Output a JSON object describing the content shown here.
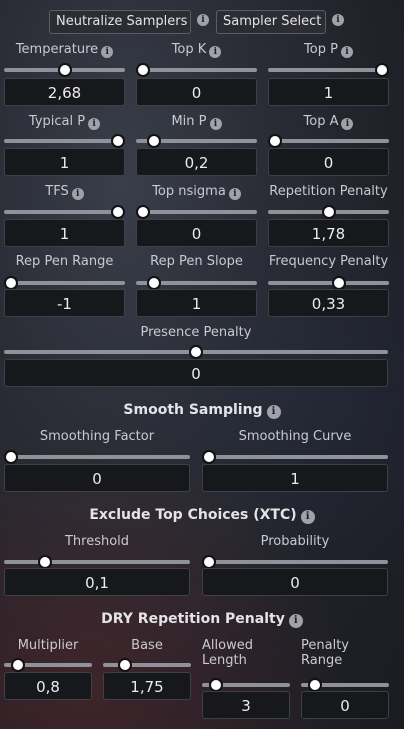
{
  "top_buttons": {
    "neutralize": "Neutralize Samplers",
    "sampler_select": "Sampler Select"
  },
  "params": {
    "temperature": {
      "label": "Temperature",
      "value": "2,68",
      "has_info": true
    },
    "top_k": {
      "label": "Top K",
      "value": "0",
      "has_info": true
    },
    "top_p": {
      "label": "Top P",
      "value": "1",
      "has_info": true
    },
    "typical_p": {
      "label": "Typical P",
      "value": "1",
      "has_info": true
    },
    "min_p": {
      "label": "Min P",
      "value": "0,2",
      "has_info": true
    },
    "top_a": {
      "label": "Top A",
      "value": "0",
      "has_info": true
    },
    "tfs": {
      "label": "TFS",
      "value": "1",
      "has_info": true
    },
    "top_nsigma": {
      "label": "Top nsigma",
      "value": "0",
      "has_info": true
    },
    "repetition_penalty": {
      "label": "Repetition Penalty",
      "value": "1,78",
      "has_info": false
    },
    "rep_pen_range": {
      "label": "Rep Pen Range",
      "value": "-1",
      "has_info": false
    },
    "rep_pen_slope": {
      "label": "Rep Pen Slope",
      "value": "1",
      "has_info": false
    },
    "frequency_penalty": {
      "label": "Frequency Penalty",
      "value": "0,33",
      "has_info": false
    },
    "presence_penalty": {
      "label": "Presence Penalty",
      "value": "0",
      "has_info": false
    }
  },
  "smooth_sampling": {
    "title": "Smooth Sampling",
    "factor": {
      "label": "Smoothing Factor",
      "value": "0"
    },
    "curve": {
      "label": "Smoothing Curve",
      "value": "1"
    }
  },
  "xtc": {
    "title": "Exclude Top Choices (XTC)",
    "threshold": {
      "label": "Threshold",
      "value": "0,1"
    },
    "probability": {
      "label": "Probability",
      "value": "0"
    }
  },
  "dry": {
    "title": "DRY Repetition Penalty",
    "multiplier": {
      "label": "Multiplier",
      "value": "0,8"
    },
    "base": {
      "label": "Base",
      "value": "1,75"
    },
    "allowed_length": {
      "label_line1": "Allowed",
      "label_line2": "Length",
      "value": "3"
    },
    "penalty_range": {
      "label_line1": "Penalty",
      "label_line2": "Range",
      "value": "0"
    }
  },
  "icons": {
    "info": "info-icon"
  },
  "slider_levels": {
    "temperature": 0.5,
    "top_k": 0,
    "top_p": 1,
    "typical_p": 1,
    "min_p": 0.1,
    "top_a": 0,
    "tfs": 1,
    "top_nsigma": 0,
    "repetition_penalty": 0.5,
    "rep_pen_range": 0,
    "rep_pen_slope": 0.1,
    "frequency_penalty": 0.6,
    "presence_penalty": 0.5,
    "smoothing_factor": 0,
    "smoothing_curve": 0,
    "xtc_threshold": 0.2,
    "xtc_probability": 0,
    "dry_multiplier": 0.1,
    "dry_base": 0.2,
    "dry_allowed_length": 0.1,
    "dry_penalty_range": 0.1
  }
}
